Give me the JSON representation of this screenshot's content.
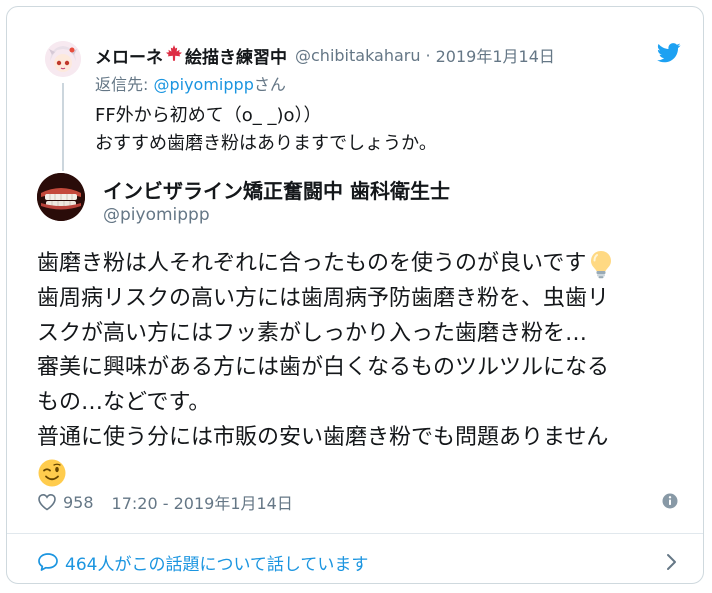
{
  "parent_tweet": {
    "display_name": "メローネ",
    "display_name_suffix": "絵描き練習中",
    "handle": "@chibitakaharu",
    "separator": "·",
    "date": "2019年1月14日",
    "reply_label": "返信先: ",
    "reply_mention": "@piyomippp",
    "reply_suffix": "さん",
    "text_lines": [
      "FF外から初めて（o_ _)o））",
      "おすすめ歯磨き粉はありますでしょうか。"
    ]
  },
  "main_tweet": {
    "display_name": "インビザライン矯正奮闘中 歯科衛生士",
    "handle": "@piyomippp",
    "text_lines": [
      "歯磨き粉は人それぞれに合ったものを使うのが良いです",
      "歯周病リスクの高い方には歯周病予防歯磨き粉を、虫歯リ",
      "スクが高い方にはフッ素がしっかり入った歯磨き粉を…",
      "審美に興味がある方には歯が白くなるものツルツルになる",
      "もの…などです。",
      "普通に使う分には市販の安い歯磨き粉でも問題ありません"
    ],
    "like_count": "958",
    "timestamp": "17:20 - 2019年1月14日"
  },
  "footer": {
    "conversation_label": "464人がこの話題について話しています"
  },
  "icons": {
    "brand": "twitter-bird-icon",
    "emoji_1": "light-bulb-emoji",
    "emoji_2": "winking-face-emoji",
    "flag": "maple-leaf-emoji"
  },
  "colors": {
    "link": "#1b95e0",
    "muted": "#657786",
    "text": "#14171a",
    "border": "#cfd9de"
  }
}
